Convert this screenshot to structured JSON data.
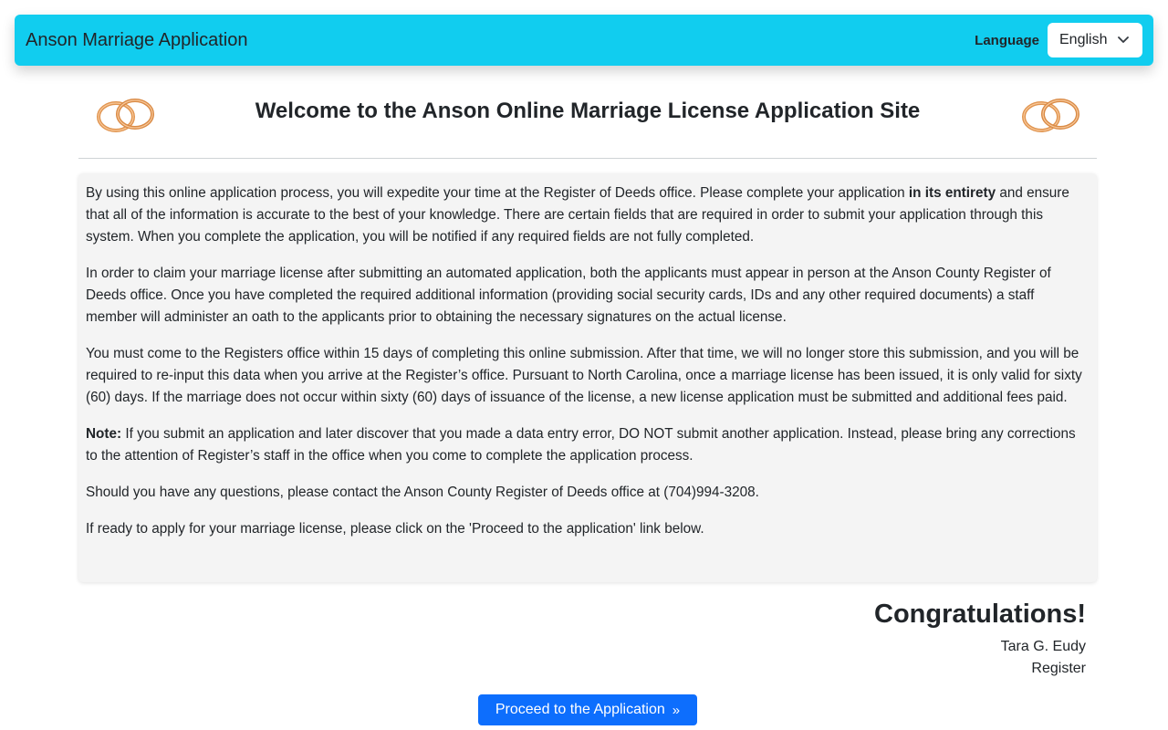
{
  "navbar": {
    "brand": "Anson Marriage Application",
    "language_label": "Language",
    "language_selected": "English"
  },
  "header": {
    "title": "Welcome to the Anson Online Marriage License Application Site"
  },
  "info": {
    "p1_before": "By using this online application process, you will expedite your time at the Register of Deeds office. Please complete your application ",
    "p1_bold": "in its entirety",
    "p1_after": " and ensure that all of the information is accurate to the best of your knowledge. There are certain fields that are required in order to submit your application through this system. When you complete the application, you will be notified if any required fields are not fully completed.",
    "p2": "In order to claim your marriage license after submitting an automated application, both the applicants must appear in person at the Anson County Register of Deeds office. Once you have completed the required additional information (providing social security cards, IDs and any other required documents) a staff member will administer an oath to the applicants prior to obtaining the necessary signatures on the actual license.",
    "p3": "You must come to the Registers office within 15 days of completing this online submission. After that time, we will no longer store this submission, and you will be required to re-input this data when you arrive at the Register’s office. Pursuant to North Carolina, once a marriage license has been issued, it is only valid for sixty (60) days. If the marriage does not occur within sixty (60) days of issuance of the license, a new license application must be submitted and additional fees paid.",
    "p4_bold": "Note:",
    "p4_after": " If you submit an application and later discover that you made a data entry error, DO NOT submit another application. Instead, please bring any corrections to the attention of Register’s staff in the office when you come to complete the application process.",
    "p5": "Should you have any questions, please contact the Anson County Register of Deeds office at (704)994-3208.",
    "p6": "If ready to apply for your marriage license, please click on the 'Proceed to the application' link below."
  },
  "closing": {
    "congrats": "Congratulations!",
    "signer_name": "Tara G. Eudy",
    "signer_title": "Register"
  },
  "cta": {
    "label": "Proceed to the Application",
    "arrow": "»"
  },
  "icons": {
    "rings": "wedding-rings-icon",
    "chevron": "chevron-down-icon"
  },
  "colors": {
    "navbar": "#11cdef",
    "primary_button": "#0d6efd",
    "card_background": "#f4f4f4",
    "ring_gold": "#e0944f"
  }
}
